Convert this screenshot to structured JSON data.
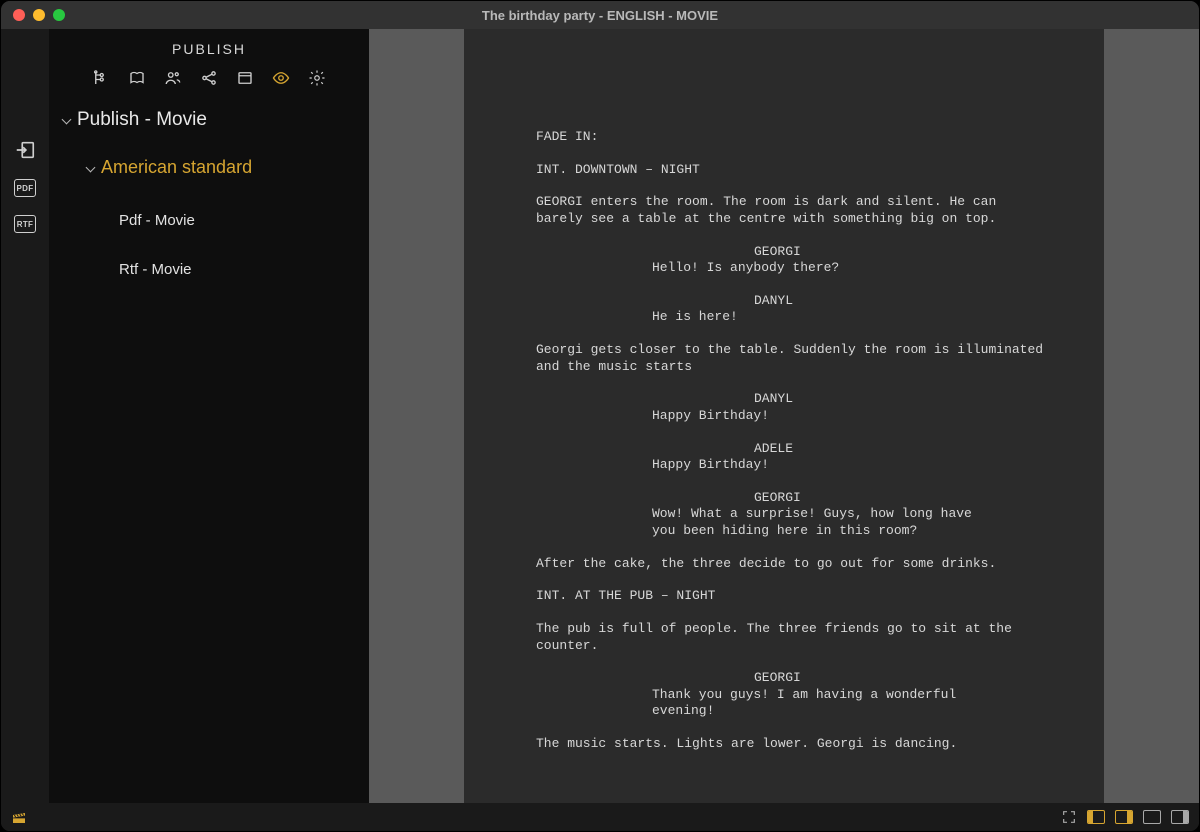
{
  "window": {
    "title": "The birthday party - ENGLISH - MOVIE"
  },
  "sidebar": {
    "title": "PUBLISH",
    "tree": {
      "root": "Publish - Movie",
      "group": "American standard",
      "item_pdf": "Pdf - Movie",
      "item_rtf": "Rtf - Movie"
    }
  },
  "rail": {
    "pdf_label": "PDF",
    "rtf_label": "RTF"
  },
  "script": {
    "blocks": [
      {
        "type": "trans",
        "text": "FADE IN:"
      },
      {
        "type": "scene",
        "text": "INT. DOWNTOWN – NIGHT"
      },
      {
        "type": "act",
        "text": "GEORGI enters the room. The room is dark and silent. He can barely see a table at the centre with something big on top."
      },
      {
        "type": "char",
        "text": "GEORGI"
      },
      {
        "type": "dlg",
        "text": "Hello! Is anybody there?"
      },
      {
        "type": "char",
        "text": "DANYL"
      },
      {
        "type": "dlg",
        "text": "He is here!"
      },
      {
        "type": "act",
        "text": "Georgi gets closer to the table. Suddenly the room is illuminated and the music starts"
      },
      {
        "type": "char",
        "text": "DANYL"
      },
      {
        "type": "dlg",
        "text": "Happy Birthday!"
      },
      {
        "type": "char",
        "text": "ADELE"
      },
      {
        "type": "dlg",
        "text": "Happy Birthday!"
      },
      {
        "type": "char",
        "text": "GEORGI"
      },
      {
        "type": "dlg",
        "text": "Wow! What a surprise! Guys, how long have you been hiding here in this room?"
      },
      {
        "type": "act",
        "text": "After the cake, the three decide to go out for some drinks."
      },
      {
        "type": "scene",
        "text": "INT. AT THE PUB – NIGHT"
      },
      {
        "type": "act",
        "text": "The pub is full of people. The three friends go to sit at the counter."
      },
      {
        "type": "char",
        "text": "GEORGI"
      },
      {
        "type": "dlg",
        "text": "Thank you guys! I am having a wonderful evening!"
      },
      {
        "type": "act",
        "text": "The music starts. Lights are lower. Georgi is dancing."
      }
    ]
  }
}
